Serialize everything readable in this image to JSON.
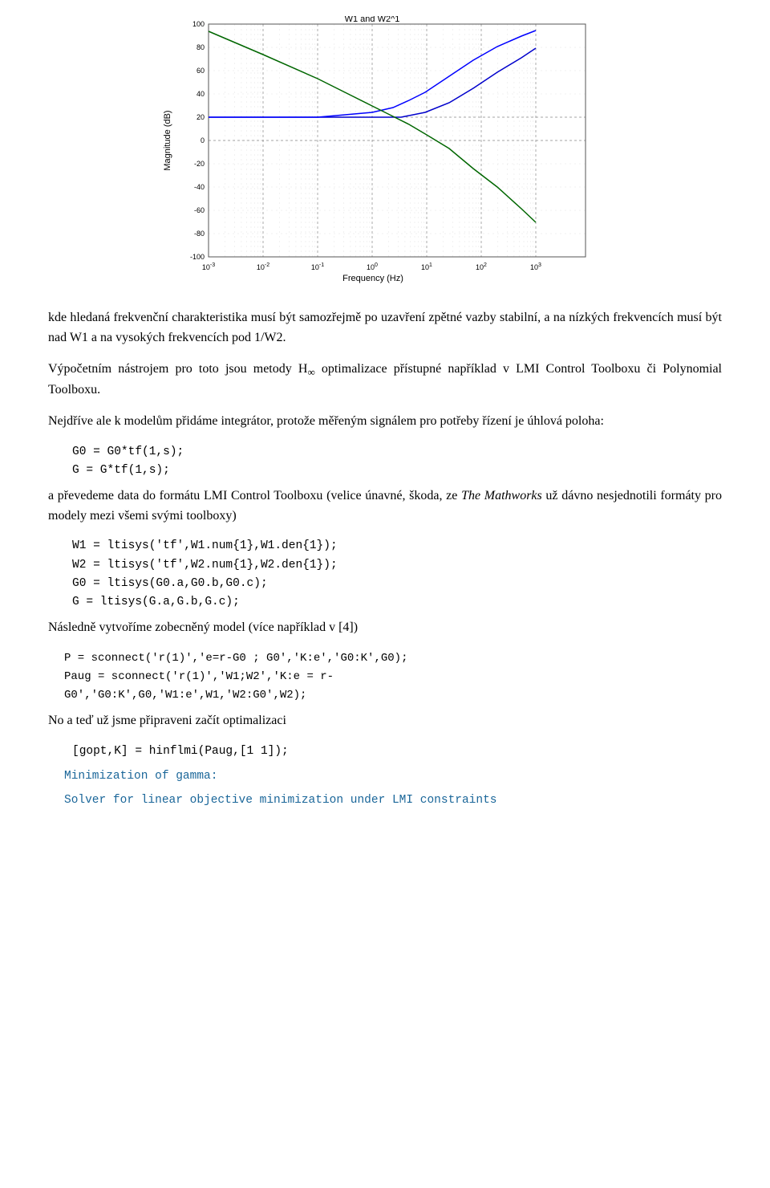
{
  "chart": {
    "title": "W1 and W2^1",
    "x_label": "Frequency (Hz)",
    "y_label": "Magnitude (dB)",
    "x_ticks": [
      "10⁻³",
      "10⁻²",
      "10⁻¹",
      "10⁰",
      "10¹",
      "10²",
      "10³"
    ],
    "y_ticks": [
      "-100",
      "-80",
      "-60",
      "-40",
      "-20",
      "0",
      "20",
      "40",
      "60",
      "80",
      "100"
    ]
  },
  "paragraphs": {
    "p1": "kde hledaná frekvenční charakteristika musí být samozřejmě po uzavření zpětné vazby stabilní, a na nízkých frekvencích musí být nad W1 a  na vysokých frekvencích pod 1/W2.",
    "p2_prefix": "Výpočetním nástrojem pro toto jsou metody H",
    "p2_inf": "∞",
    "p2_suffix": " optimalizace přístupné například v LMI Control Toolboxu či Polynomial Toolboxu.",
    "p3": "Nejdříve ale k modelům přidáme integrátor, protože měřeným signálem pro potřeby řízení je úhlová poloha:",
    "code1_line1": "G0 = G0*tf(1,s);",
    "code1_line2": "G = G*tf(1,s);",
    "p4_prefix": "a převedeme data do formátu LMI Control Toolboxu (velice únavné, škoda, ze ",
    "p4_italic": "The Mathworks",
    "p4_suffix": " už dávno nesjednotili formáty pro modely mezi všemi svými toolboxy)",
    "code2_line1": "W1 = ltisys('tf',W1.num{1},W1.den{1});",
    "code2_line2": "W2 = ltisys('tf',W2.num{1},W2.den{1});",
    "code2_line3": "G0 = ltisys(G0.a,G0.b,G0.c);",
    "code2_line4": "G = ltisys(G.a,G.b,G.c);",
    "p5": "Následně vytvoříme zobecněný model (více například v [4])",
    "code3_line1": "P = sconnect('r(1)','e=r-G0 ; G0','K:e','G0:K',G0);",
    "code3_line2": "Paug = sconnect('r(1)','W1;W2','K:e = r-",
    "code3_line3": "G0','G0:K',G0,'W1:e',W1,'W2:G0',W2);",
    "p6": "No a teď už jsme připraveni začít optimalizaci",
    "code4_line1": "[gopt,K] = hinflmi(Paug,[1 1]);",
    "p7": "Minimization of gamma:",
    "p8": "Solver for linear objective minimization under LMI constraints"
  }
}
